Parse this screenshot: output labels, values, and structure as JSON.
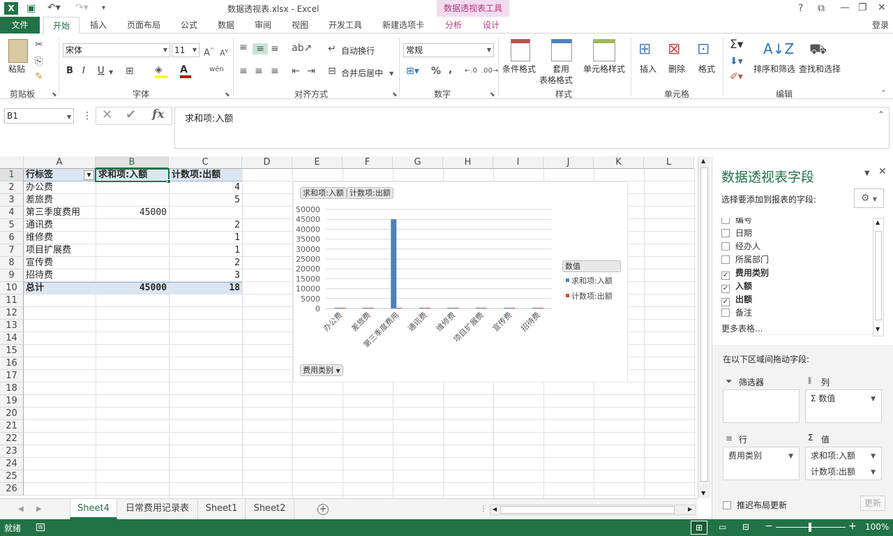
{
  "window": {
    "title": "数据透视表.xlsx - Excel",
    "context_tools": "数据透视表工具",
    "sign_in": "登录"
  },
  "tabs": [
    "文件",
    "开始",
    "插入",
    "页面布局",
    "公式",
    "数据",
    "审阅",
    "视图",
    "开发工具",
    "新建选项卡",
    "分析",
    "设计"
  ],
  "ribbon": {
    "clipboard": {
      "paste": "粘贴",
      "group": "剪贴板"
    },
    "font": {
      "name": "宋体",
      "size": "11",
      "bold": "B",
      "italic": "I",
      "underline": "U",
      "fontcolor": "A",
      "wen": "wén",
      "group": "字体"
    },
    "align": {
      "wrap": "自动换行",
      "merge": "合并后居中",
      "group": "对齐方式"
    },
    "number": {
      "format": "常规",
      "percent": "%",
      "comma": ",",
      "group": "数字"
    },
    "styles": {
      "cond": "条件格式",
      "table1": "套用",
      "table2": "表格格式",
      "cell": "单元格样式",
      "group": "样式"
    },
    "cells": {
      "insert": "插入",
      "delete": "删除",
      "format": "格式",
      "group": "单元格"
    },
    "editing": {
      "sort": "排序和筛选",
      "find": "查找和选择",
      "group": "编辑"
    }
  },
  "formula_bar": {
    "name_box": "B1",
    "fx": "fx",
    "content": "求和项:入额"
  },
  "grid": {
    "columns": [
      "A",
      "B",
      "C",
      "D",
      "E",
      "F",
      "G",
      "H",
      "I",
      "J",
      "K",
      "L"
    ],
    "rows": [
      "1",
      "2",
      "3",
      "4",
      "5",
      "6",
      "7",
      "8",
      "9",
      "10",
      "11",
      "12",
      "13",
      "14",
      "15",
      "16",
      "17",
      "18",
      "19",
      "20",
      "21",
      "22",
      "23",
      "24",
      "25",
      "26"
    ],
    "header": {
      "a": "行标签",
      "b": "求和项:入额",
      "c": "计数项:出额"
    },
    "data": [
      {
        "a": "办公费",
        "b": "",
        "c": "4"
      },
      {
        "a": "差旅费",
        "b": "",
        "c": "5"
      },
      {
        "a": "第三季度费用",
        "b": "45000",
        "c": ""
      },
      {
        "a": "通讯费",
        "b": "",
        "c": "2"
      },
      {
        "a": "维修费",
        "b": "",
        "c": "1"
      },
      {
        "a": "项目扩展费",
        "b": "",
        "c": "1"
      },
      {
        "a": "宣传费",
        "b": "",
        "c": "2"
      },
      {
        "a": "招待费",
        "b": "",
        "c": "3"
      }
    ],
    "total": {
      "a": "总计",
      "b": "45000",
      "c": "18"
    }
  },
  "chart_data": {
    "type": "bar",
    "value_buttons": [
      "求和项:入额",
      "计数项:出额"
    ],
    "axis_field_button": "费用类别",
    "legend_title": "数值",
    "legend_placement": "right",
    "categories": [
      "办公费",
      "差旅费",
      "第三季度费用",
      "通讯费",
      "维修费",
      "项目扩展费",
      "宣传费",
      "招待费"
    ],
    "series": [
      {
        "name": "求和项:入额",
        "color": "#4f81bd",
        "values": [
          0,
          0,
          45000,
          0,
          0,
          0,
          0,
          0
        ]
      },
      {
        "name": "计数项:出额",
        "color": "#c0504d",
        "values": [
          4,
          5,
          0,
          2,
          1,
          1,
          2,
          3
        ]
      }
    ],
    "ylim": [
      0,
      50000
    ],
    "yticks": [
      "50000",
      "45000",
      "40000",
      "35000",
      "30000",
      "25000",
      "20000",
      "15000",
      "10000",
      "5000",
      "0"
    ],
    "grid": true
  },
  "sheet_tabs": [
    "Sheet4",
    "日常费用记录表",
    "Sheet1",
    "Sheet2"
  ],
  "status": {
    "ready": "就绪",
    "zoom": "100%"
  },
  "pane": {
    "title": "数据透视表字段",
    "subtitle": "选择要添加到报表的字段:",
    "fields": [
      {
        "label": "编号",
        "checked": false
      },
      {
        "label": "日期",
        "checked": false
      },
      {
        "label": "经办人",
        "checked": false
      },
      {
        "label": "所属部门",
        "checked": false
      },
      {
        "label": "费用类别",
        "checked": true
      },
      {
        "label": "入额",
        "checked": true
      },
      {
        "label": "出额",
        "checked": true
      },
      {
        "label": "备注",
        "checked": false
      }
    ],
    "more": "更多表格...",
    "drag_hint": "在以下区域间拖动字段:",
    "filters_label": "筛选器",
    "columns_label": "列",
    "columns_item": "数值",
    "rows_label": "行",
    "rows_item": "费用类别",
    "values_label": "值",
    "values_items": [
      "求和项:入额",
      "计数项:出额"
    ],
    "defer": "推迟布局更新",
    "update": "更新"
  }
}
